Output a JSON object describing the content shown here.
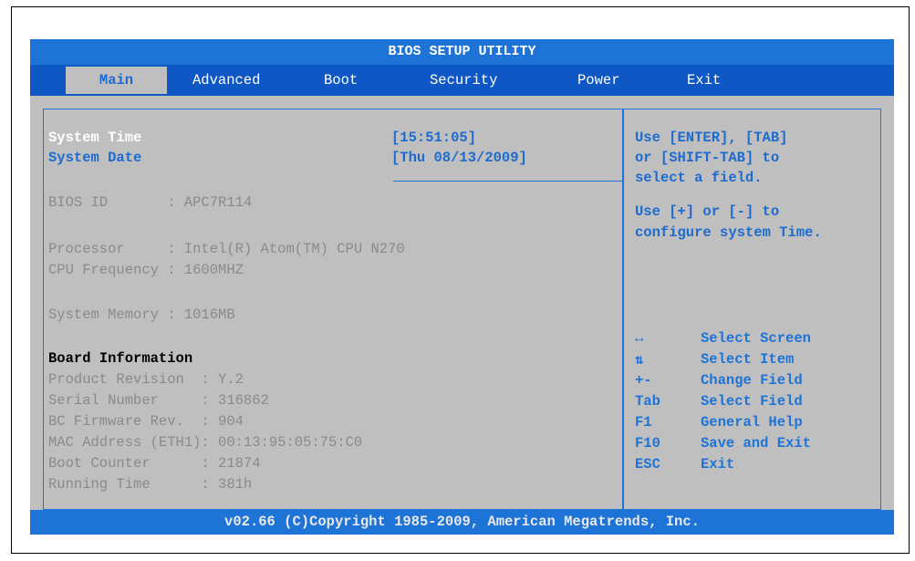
{
  "title": "BIOS SETUP UTILITY",
  "tabs": [
    {
      "label": "Main"
    },
    {
      "label": "Advanced"
    },
    {
      "label": "Boot"
    },
    {
      "label": "Security"
    },
    {
      "label": "Power"
    },
    {
      "label": "Exit"
    }
  ],
  "main": {
    "system_time": {
      "label": "System Time",
      "value": "[15:51:05]"
    },
    "system_date": {
      "label": "System Date",
      "value": "[Thu 08/13/2009]"
    },
    "bios_id": "BIOS ID       : APC7R114",
    "processor": "Processor     : Intel(R) Atom(TM) CPU N270",
    "cpu_frequency": "CPU Frequency : 1600MHZ",
    "system_memory": "System Memory : 1016MB",
    "board_heading": "Board Information",
    "board_rows": [
      "Product Revision  : Y.2",
      "Serial Number     : 316862",
      "BC Firmware Rev.  : 904",
      "MAC Address (ETH1): 00:13:95:05:75:C0",
      "Boot Counter      : 21874",
      "Running Time      : 381h"
    ]
  },
  "help": {
    "lines": [
      "Use [ENTER], [TAB]",
      "or [SHIFT-TAB] to",
      "select a field.",
      "",
      "Use [+] or [-] to",
      "configure system Time."
    ],
    "keys": [
      {
        "key": "↔",
        "desc": "Select Screen",
        "icon": "left-right-arrow-icon"
      },
      {
        "key": "⇅",
        "desc": "Select Item",
        "icon": "up-down-arrow-icon"
      },
      {
        "key": "+-",
        "desc": "Change Field"
      },
      {
        "key": "Tab",
        "desc": "Select Field"
      },
      {
        "key": "F1",
        "desc": "General Help"
      },
      {
        "key": "F10",
        "desc": "Save and Exit"
      },
      {
        "key": "ESC",
        "desc": "Exit"
      }
    ]
  },
  "footer": "v02.66 (C)Copyright 1985-2009, American Megatrends, Inc.",
  "colors": {
    "title_bar": "#1e73d6",
    "tab_bar": "#0e57c4",
    "panel": "#bfbfbf",
    "accent_text": "#1d6bcf"
  }
}
